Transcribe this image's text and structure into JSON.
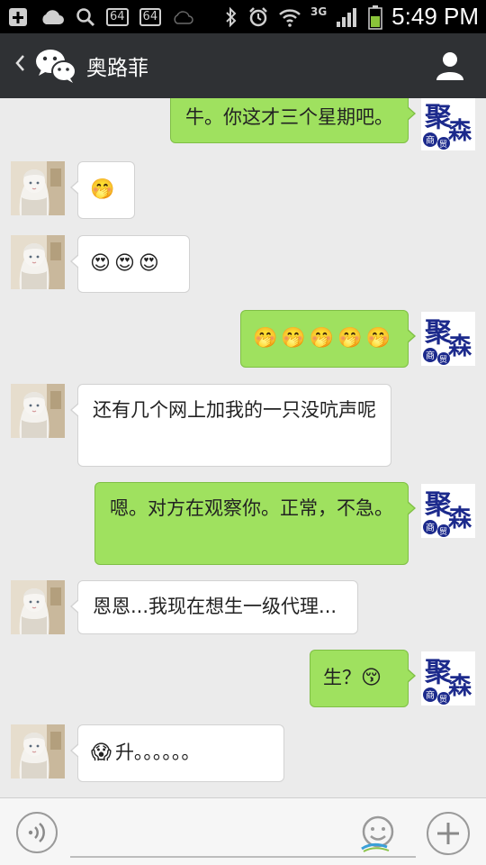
{
  "status_bar": {
    "chip1": "64",
    "chip2": "64",
    "network": "3G",
    "time": "5:49 PM"
  },
  "header": {
    "title": "奥路菲"
  },
  "brand_avatar": {
    "big_char": "聚",
    "side_char": "森",
    "small_chars": [
      "商",
      "贸"
    ]
  },
  "messages": [
    {
      "side": "right",
      "text": "牛。你这才三个星期吧。"
    },
    {
      "side": "left",
      "emojis": [
        "🤭"
      ],
      "text": ""
    },
    {
      "side": "left",
      "emojis": [
        "😍",
        "😍",
        "😍"
      ],
      "text": ""
    },
    {
      "side": "right",
      "emojis": [
        "🤭",
        "🤭",
        "🤭",
        "🤭",
        "🤭"
      ],
      "text": ""
    },
    {
      "side": "left",
      "text": "还有几个网上加我的一只没吭声呢"
    },
    {
      "side": "right",
      "text": "嗯。对方在观察你。正常，不急。"
    },
    {
      "side": "left",
      "text": "恩恩...我现在想生一级代理..."
    },
    {
      "side": "right",
      "text": "生？",
      "emojis_after": [
        "😚"
      ]
    },
    {
      "side": "left",
      "emojis": [
        "😱"
      ],
      "text": "升。。。。。。"
    }
  ],
  "colors": {
    "sent_bubble": "#9fe15f",
    "received_bubble": "#ffffff",
    "header_bg": "#2f3134",
    "chat_bg": "#ebebeb",
    "brand_blue": "#1c2a8c"
  },
  "input_bar": {
    "text_value": "",
    "icons": [
      "voice-icon",
      "emoji-icon",
      "plus-icon"
    ]
  }
}
